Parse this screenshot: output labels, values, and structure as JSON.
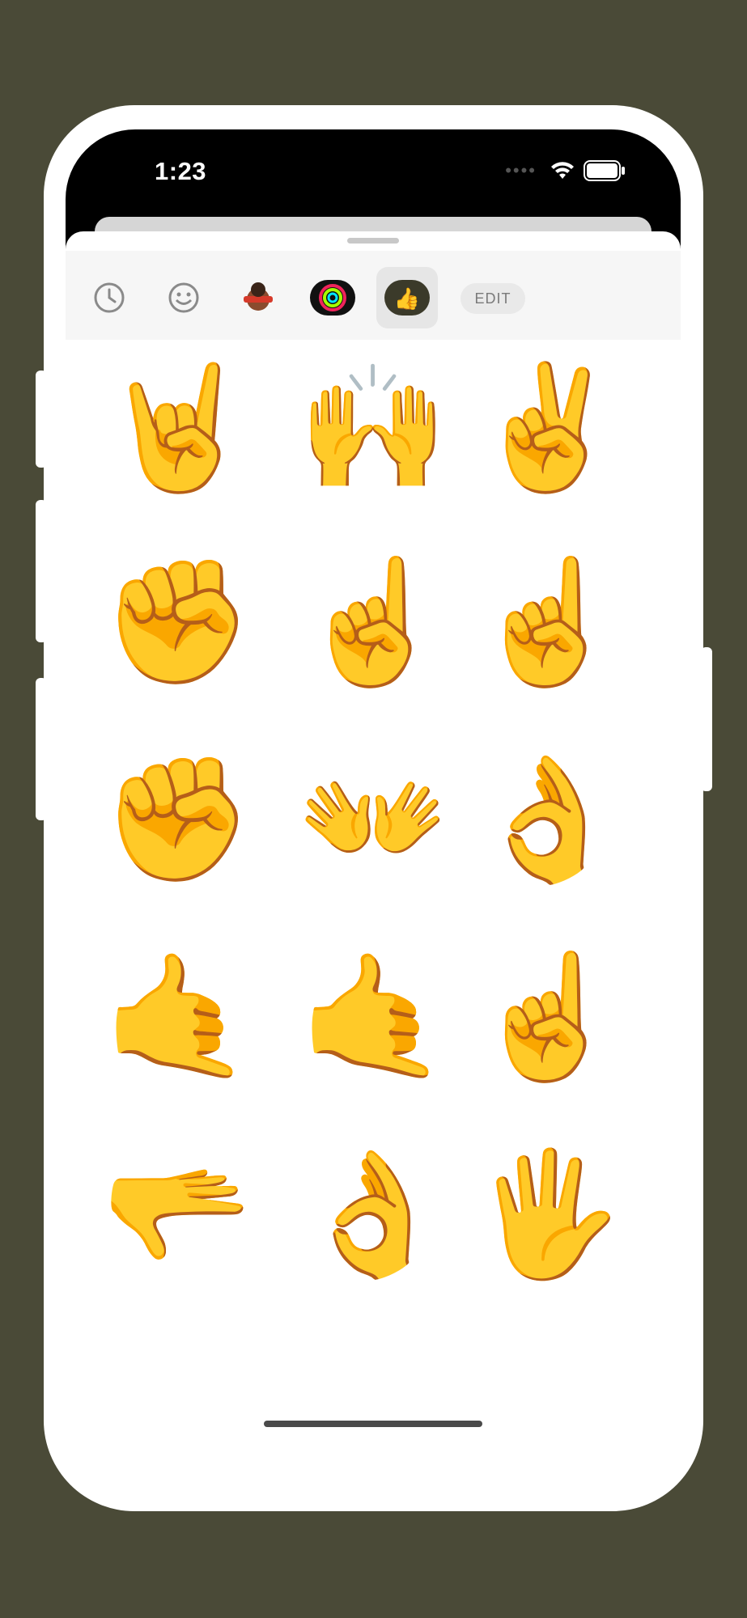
{
  "status_bar": {
    "time": "1:23"
  },
  "top_toolbar": {
    "items": [
      {
        "name": "recent-clock-icon"
      },
      {
        "name": "smiley-icon"
      },
      {
        "name": "memoji-sticker-icon"
      },
      {
        "name": "activity-rings-icon"
      },
      {
        "name": "thumbs-up-sticker-icon",
        "active": true
      }
    ],
    "edit_label": "EDIT"
  },
  "stickers": [
    {
      "name": "rock-on-hand-sticker",
      "emoji": "🤘",
      "face": "≧◡≦"
    },
    {
      "name": "clapping-hands-sticker",
      "emoji": "🙌",
      "face": "◉◉"
    },
    {
      "name": "peace-rainbow-sticker",
      "emoji": "✌️",
      "face": "˘◡˘"
    },
    {
      "name": "fist-sticker",
      "emoji": "✊",
      "face": ""
    },
    {
      "name": "pointing-up-hand-sticker",
      "emoji": "☝️",
      "face": "◔◡◔"
    },
    {
      "name": "monocle-hand-sticker",
      "emoji": "☝️",
      "face": "◡⊙"
    },
    {
      "name": "angry-fist-sticker",
      "emoji": "✊",
      "face": "ಠ_ಠ"
    },
    {
      "name": "two-hands-sticker",
      "emoji": "👐",
      "face": "◉◉"
    },
    {
      "name": "ok-hand-sticker",
      "emoji": "👌",
      "face": "◔◔"
    },
    {
      "name": "coffee-hand-sticker",
      "emoji": "🤙",
      "face": "▭▭"
    },
    {
      "name": "sunglasses-shaka-sticker",
      "emoji": "🤙",
      "face": "▀▀"
    },
    {
      "name": "index-up-hand-sticker",
      "emoji": "☝️",
      "face": "︶︶"
    },
    {
      "name": "question-hand-sticker",
      "emoji": "🫳",
      "face": "◉◉"
    },
    {
      "name": "ok-sign-hand-sticker",
      "emoji": "👌",
      "face": "◉◉"
    },
    {
      "name": "open-hand-sticker",
      "emoji": "🖐️",
      "face": "◡◡"
    }
  ],
  "bottom_bar": {
    "items": [
      {
        "name": "menu-icon"
      },
      {
        "name": "star-icon"
      },
      {
        "name": "recent-clock-icon"
      },
      {
        "name": "hand-pack-icon",
        "emoji": "🖐️",
        "active": true
      },
      {
        "name": "heart-fist-pack-icon",
        "emoji": "🫶"
      },
      {
        "name": "pointing-hand-pack-icon",
        "emoji": "☝️"
      },
      {
        "name": "heart-hands-pack-icon",
        "emoji": "🫶"
      },
      {
        "name": "partial-pack-icon",
        "emoji": "🎈"
      },
      {
        "name": "expand-icon"
      }
    ]
  }
}
